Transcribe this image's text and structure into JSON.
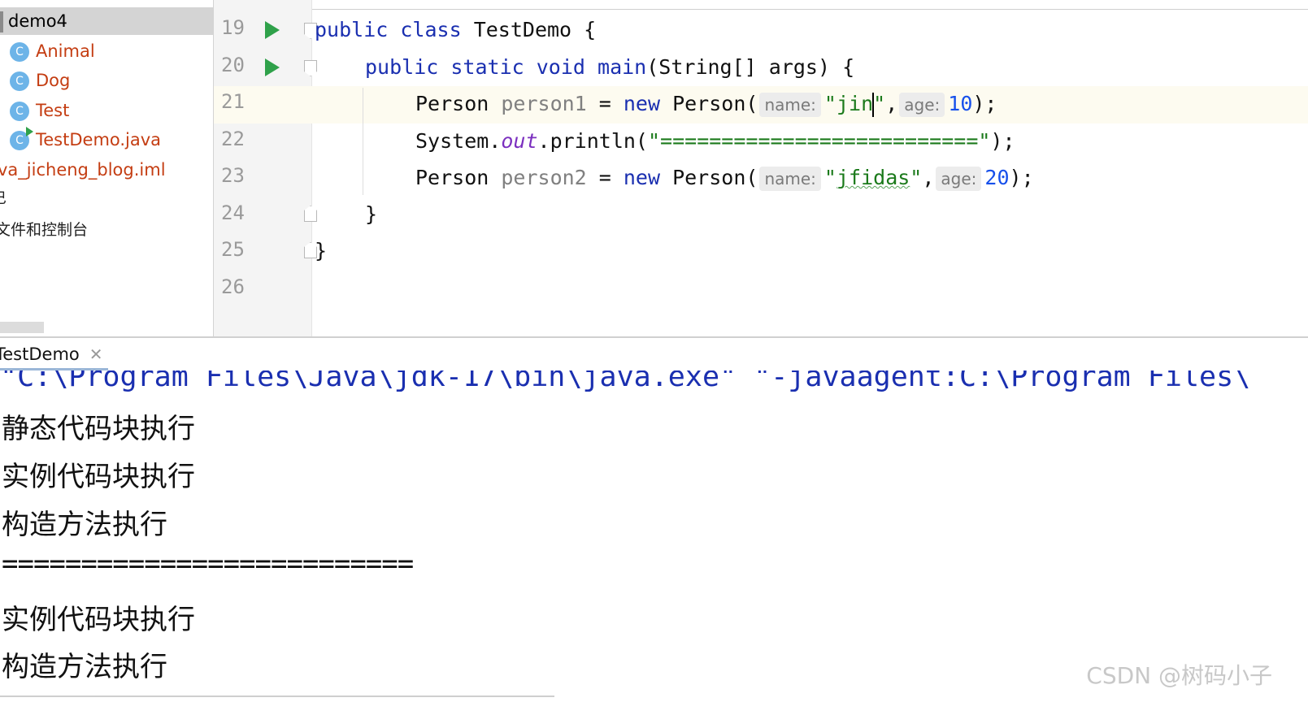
{
  "project_tree": {
    "items": [
      {
        "label": "demo4",
        "kind": "folder",
        "selected": true
      },
      {
        "label": "Animal",
        "kind": "class",
        "icon": "class-icon"
      },
      {
        "label": "Dog",
        "kind": "class",
        "icon": "class-icon"
      },
      {
        "label": "Test",
        "kind": "class",
        "icon": "class-icon"
      },
      {
        "label": "TestDemo.java",
        "kind": "runnable-class",
        "icon": "class-run-icon"
      },
      {
        "label": "va_jicheng_blog.iml",
        "kind": "file"
      },
      {
        "label": "⺒",
        "kind": "partial"
      },
      {
        "label": "文件和控制台",
        "kind": "partial"
      }
    ]
  },
  "editor": {
    "line_numbers": [
      "19",
      "20",
      "21",
      "22",
      "23",
      "24",
      "25",
      "26"
    ],
    "lines": {
      "l19": {
        "kw1": "public",
        "kw2": "class",
        "rest": " TestDemo {"
      },
      "l20": {
        "kw1": "public",
        "kw2": "static",
        "kw3": "void",
        "method": "main",
        "rest": "(String[] args) {"
      },
      "l21": {
        "type": "Person ",
        "var": "person1",
        "assign": " = ",
        "kw": "new",
        "ctor": " Person(",
        "hint_name": "name:",
        "str_open": "\"jin",
        "str_close": "\"",
        "comma": ",",
        "hint_age": "age:",
        "num": "10",
        "end": ");"
      },
      "l22": {
        "cls": "System.",
        "field": "out",
        "call": ".println(",
        "str": "\"==========================\"",
        "end": ");"
      },
      "l23": {
        "type": "Person ",
        "var": "person2",
        "assign": " = ",
        "kw": "new",
        "ctor": " Person(",
        "hint_name": "name:",
        "str_q1": "\"",
        "str_body": "jfidas",
        "str_q2": "\"",
        "comma": ",",
        "hint_age": "age:",
        "num": "20",
        "end": ");"
      },
      "l24": {
        "text": "}"
      },
      "l25": {
        "text": "}"
      }
    }
  },
  "run_window": {
    "tab_label": "TestDemo",
    "command": "\"C:\\Program Files\\Java\\jdk-17\\bin\\java.exe\" \"-javaagent:C:\\Program Files\\",
    "output": [
      "静态代码块执行",
      "实例代码块执行",
      "构造方法执行",
      "==========================",
      "实例代码块执行",
      "构造方法执行"
    ]
  },
  "watermark": "CSDN @树码小子",
  "colors": {
    "keyword": "#1a2fb0",
    "string": "#1b7a1b",
    "number": "#1750eb",
    "class_name": "#c43d12",
    "run_icon": "#2fa14a"
  }
}
